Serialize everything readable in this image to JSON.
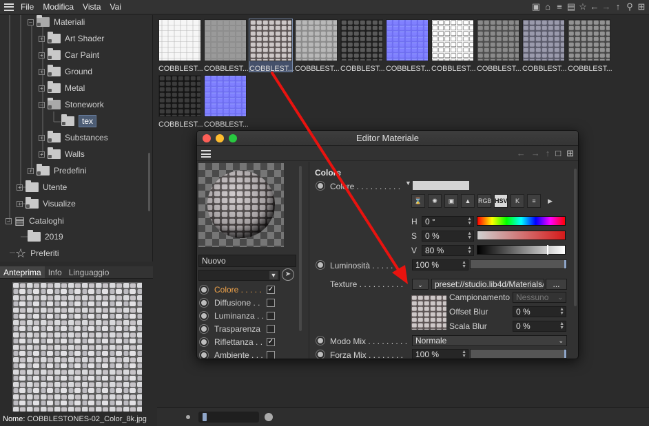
{
  "menubar": {
    "items": [
      "File",
      "Modifica",
      "Vista",
      "Vai"
    ],
    "icons": [
      "window-icon",
      "home-icon",
      "sliders-icon",
      "book-icon",
      "star-icon",
      "back-icon",
      "forward-icon",
      "up-icon",
      "search-icon",
      "add-icon"
    ]
  },
  "tree": {
    "items": [
      {
        "label": "Materiali",
        "open": true
      },
      {
        "label": "Art Shader"
      },
      {
        "label": "Car Paint"
      },
      {
        "label": "Ground"
      },
      {
        "label": "Metal"
      },
      {
        "label": "Stonework",
        "open": true
      },
      {
        "label": "tex",
        "selected": true
      },
      {
        "label": "Substances"
      },
      {
        "label": "Walls"
      },
      {
        "label": "Predefini"
      },
      {
        "label": "Utente"
      },
      {
        "label": "Visualize"
      },
      {
        "label": "Cataloghi"
      },
      {
        "label": "2019"
      },
      {
        "label": "Preferiti"
      }
    ]
  },
  "preview": {
    "tabs": [
      "Anteprima",
      "Info",
      "Linguaggio"
    ],
    "name_label": "Nome:",
    "name_value": "COBBLESTONES-02_Color_8k.jpg"
  },
  "thumbs": [
    {
      "caption": "COBBLEST...",
      "style": "white"
    },
    {
      "caption": "COBBLEST...",
      "style": "grey"
    },
    {
      "caption": "COBBLEST...",
      "style": "color",
      "selected": true
    },
    {
      "caption": "COBBLEST...",
      "style": "light"
    },
    {
      "caption": "COBBLEST...",
      "style": "dark"
    },
    {
      "caption": "COBBLEST...",
      "style": "normal"
    },
    {
      "caption": "COBBLEST...",
      "style": "whitegrid"
    },
    {
      "caption": "COBBLEST...",
      "style": "mid"
    },
    {
      "caption": "COBBLEST...",
      "style": "bluegrey"
    },
    {
      "caption": "COBBLEST...",
      "style": "mid2"
    },
    {
      "caption": "COBBLEST...",
      "style": "black"
    },
    {
      "caption": "COBBLEST...",
      "style": "normal"
    }
  ],
  "editor": {
    "title": "Editor Materiale",
    "material_name": "Nuovo",
    "channels": [
      {
        "label": "Colore . . . . .",
        "checked": true,
        "active": true
      },
      {
        "label": "Diffusione . .",
        "checked": false
      },
      {
        "label": "Luminanza . .",
        "checked": false
      },
      {
        "label": "Trasparenza",
        "checked": false
      },
      {
        "label": "Riflettanza . .",
        "checked": true
      },
      {
        "label": "Ambiente . . .",
        "checked": false
      }
    ],
    "section_title": "Colore",
    "color_label": "Colore . . . . . . . . . .",
    "color_icons": [
      "RGB",
      "HSV",
      "K"
    ],
    "h_label": "H",
    "h_value": "0 °",
    "s_label": "S",
    "s_value": "0 %",
    "v_label": "V",
    "v_value": "80 %",
    "luminosity_label": "Luminosità . . . . . . .",
    "luminosity_value": "100 %",
    "texture_label": "Texture . . . . . . . . . .",
    "texture_path": "preset://studio.lib4d/Materials/S",
    "texture_more": "...",
    "sampling_label": "Campionamento",
    "sampling_value": "Nessuno",
    "offset_blur_label": "Offset Blur",
    "offset_blur_value": "0 %",
    "scale_blur_label": "Scala Blur",
    "scale_blur_value": "0 %",
    "mix_mode_label": "Modo Mix . . . . . . . . .",
    "mix_mode_value": "Normale",
    "mix_strength_label": "Forza Mix . . . . . . . .",
    "mix_strength_value": "100 %"
  },
  "colors": {
    "annotation_arrow": "#e8130f",
    "active_channel": "#f0a34a",
    "selection": "#4c5c74"
  }
}
